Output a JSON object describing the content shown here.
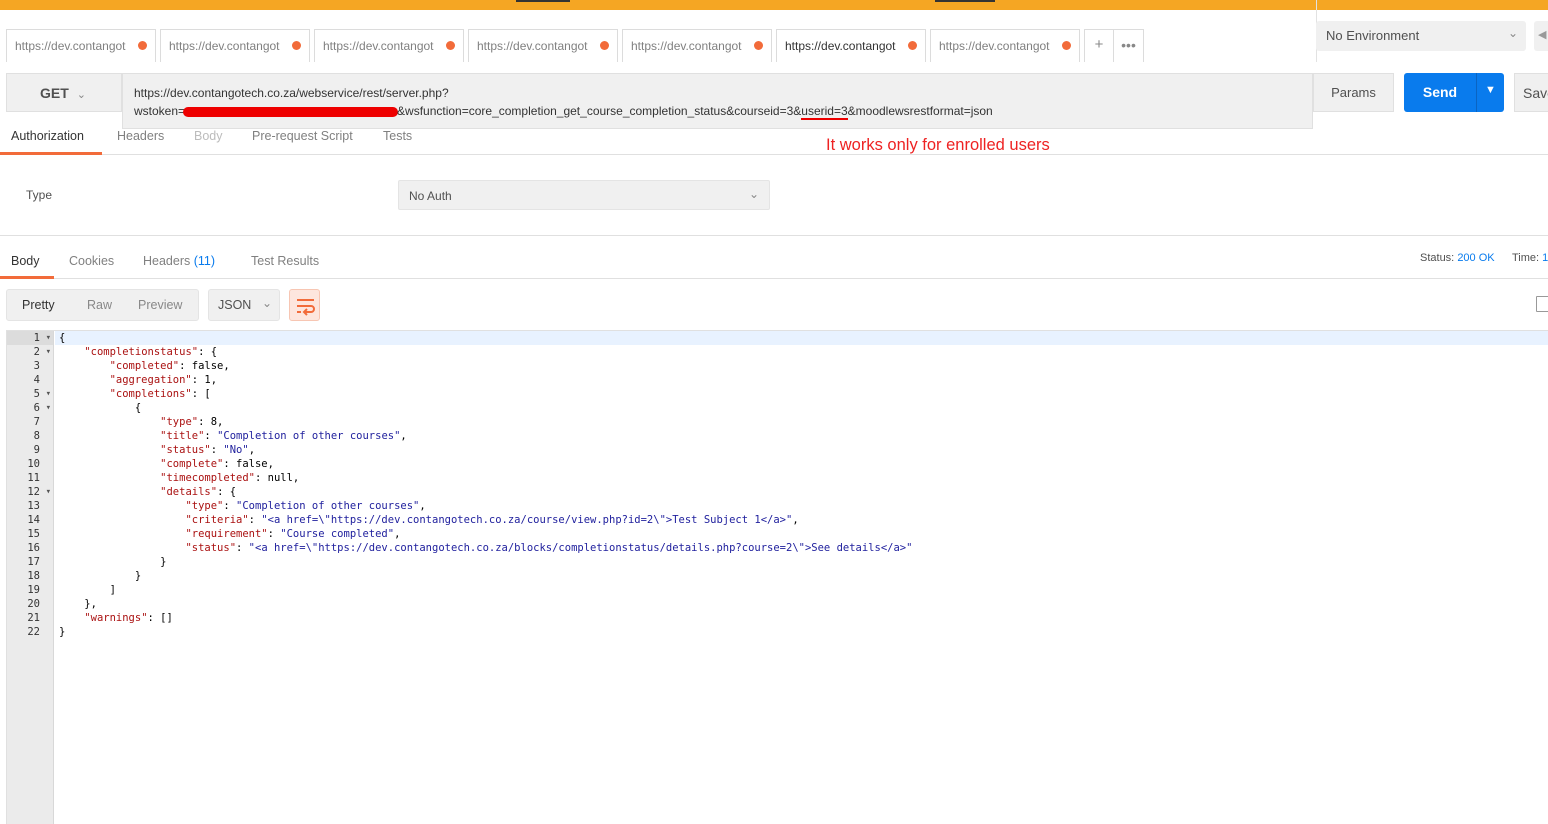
{
  "top_bar": {
    "color": "#f5a623"
  },
  "tabs": [
    {
      "label": "https://dev.contangot",
      "active": false
    },
    {
      "label": "https://dev.contangot",
      "active": false
    },
    {
      "label": "https://dev.contangot",
      "active": false
    },
    {
      "label": "https://dev.contangot",
      "active": false
    },
    {
      "label": "https://dev.contangot",
      "active": false
    },
    {
      "label": "https://dev.contangot",
      "active": true
    },
    {
      "label": "https://dev.contangot",
      "active": false
    }
  ],
  "tab_actions": {
    "add": "+",
    "more": "•••"
  },
  "environment": {
    "selected": "No Environment"
  },
  "request": {
    "method": "GET",
    "url_line1": "https://dev.contangotech.co.za/webservice/rest/server.php?",
    "url_prefix": "wstoken=",
    "url_mid": "&wsfunction=core_completion_get_course_completion_status&courseid=3&",
    "url_userid": "userid=3",
    "url_suffix": "&moodlewsrestformat=json",
    "params_label": "Params",
    "send_label": "Send",
    "save_label": "Save"
  },
  "request_tabs": [
    "Authorization",
    "Headers",
    "Body",
    "Pre-request Script",
    "Tests"
  ],
  "annotation": "It works only for enrolled users",
  "auth": {
    "type_label": "Type",
    "type_value": "No Auth"
  },
  "response_tabs": {
    "body": "Body",
    "cookies": "Cookies",
    "headers": "Headers",
    "headers_count": "(11)",
    "tests": "Test Results"
  },
  "response_status": {
    "label": "Status:",
    "value": "200 OK",
    "time_label": "Time:",
    "time_value": "1"
  },
  "view_modes": [
    "Pretty",
    "Raw",
    "Preview"
  ],
  "format": "JSON",
  "code_lines": [
    "{",
    "    \"completionstatus\": {",
    "        \"completed\": false,",
    "        \"aggregation\": 1,",
    "        \"completions\": [",
    "            {",
    "                \"type\": 8,",
    "                \"title\": \"Completion of other courses\",",
    "                \"status\": \"No\",",
    "                \"complete\": false,",
    "                \"timecompleted\": null,",
    "                \"details\": {",
    "                    \"type\": \"Completion of other courses\",",
    "                    \"criteria\": \"<a href=\\\"https://dev.contangotech.co.za/course/view.php?id=2\\\">Test Subject 1</a>\",",
    "                    \"requirement\": \"Course completed\",",
    "                    \"status\": \"<a href=\\\"https://dev.contangotech.co.za/blocks/completionstatus/details.php?course=2\\\">See details</a>\"",
    "                }",
    "            }",
    "        ]",
    "    },",
    "    \"warnings\": []",
    "}"
  ],
  "line_numbers": [
    "1",
    "2",
    "3",
    "4",
    "5",
    "6",
    "7",
    "8",
    "9",
    "10",
    "11",
    "12",
    "13",
    "14",
    "15",
    "16",
    "17",
    "18",
    "19",
    "20",
    "21",
    "22"
  ],
  "fold_lines": [
    1,
    2,
    5,
    6,
    12
  ],
  "colors": {
    "accent": "#f26b3a",
    "primary": "#097bed",
    "annotation": "#ee2222"
  }
}
